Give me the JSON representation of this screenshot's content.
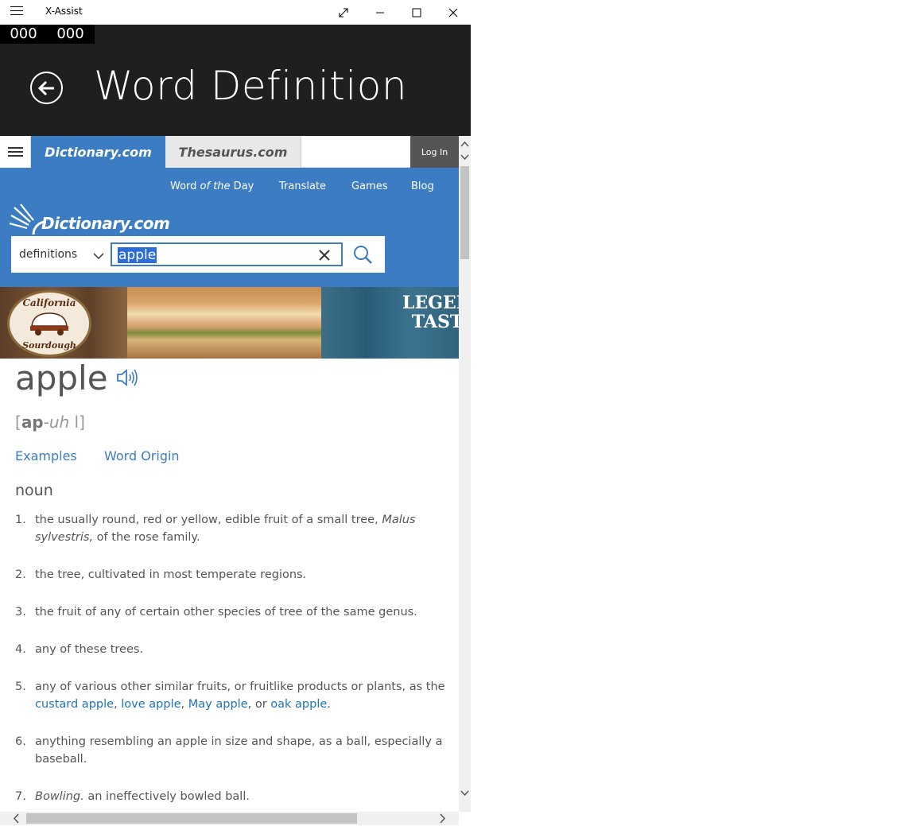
{
  "window": {
    "title": "X-Assist"
  },
  "header": {
    "counter_left": "000",
    "counter_right": "000",
    "page_title": "Word Definition"
  },
  "site": {
    "tab_dictionary": "Dictionary.com",
    "tab_thesaurus": "Thesaurus.com",
    "login": "Log In",
    "nav": {
      "word_of_day_prefix": "Word ",
      "word_of_day_em": "of the",
      "word_of_day_suffix": " Day",
      "translate": "Translate",
      "games": "Games",
      "blog": "Blog"
    },
    "logo_text": "Dictionary.com",
    "search": {
      "mode": "definitions",
      "value": "apple"
    }
  },
  "ad": {
    "badge_top": "California",
    "badge_bottom": "Sourdough",
    "legend_line1": "LEGEN",
    "legend_line2": "TAST"
  },
  "entry": {
    "headword": "apple",
    "pron_open": "[",
    "pron_bold": "ap",
    "pron_sep": "-",
    "pron_italic": "uh",
    "pron_rest": " l",
    "pron_close": "]",
    "link_examples": "Examples",
    "link_origin": "Word Origin",
    "part_of_speech": "noun",
    "definitions": {
      "d1": {
        "num": "1.",
        "a": "the usually round, red or yellow, edible fruit of a small tree, ",
        "i": "Malus sylvestris,",
        "b": " of the rose family."
      },
      "d2": {
        "num": "2.",
        "a": "the tree, cultivated in most temperate regions."
      },
      "d3": {
        "num": "3.",
        "a": "the fruit of any of certain other species of tree of the same genus."
      },
      "d4": {
        "num": "4.",
        "a": "any of these trees."
      },
      "d5": {
        "num": "5.",
        "a": "any of various other similar fruits, or fruitlike products or plants, as the ",
        "l1": "custard apple",
        "s1": ", ",
        "l2": "love apple",
        "s2": ", ",
        "l3": "May apple",
        "s3": ", or ",
        "l4": "oak apple",
        "s4": "."
      },
      "d6": {
        "num": "6.",
        "a": "anything resembling an apple in size and shape, as a ball, especially a baseball."
      },
      "d7": {
        "num": "7.",
        "i": "Bowling.",
        "a": " an ineffectively bowled ball."
      }
    }
  }
}
